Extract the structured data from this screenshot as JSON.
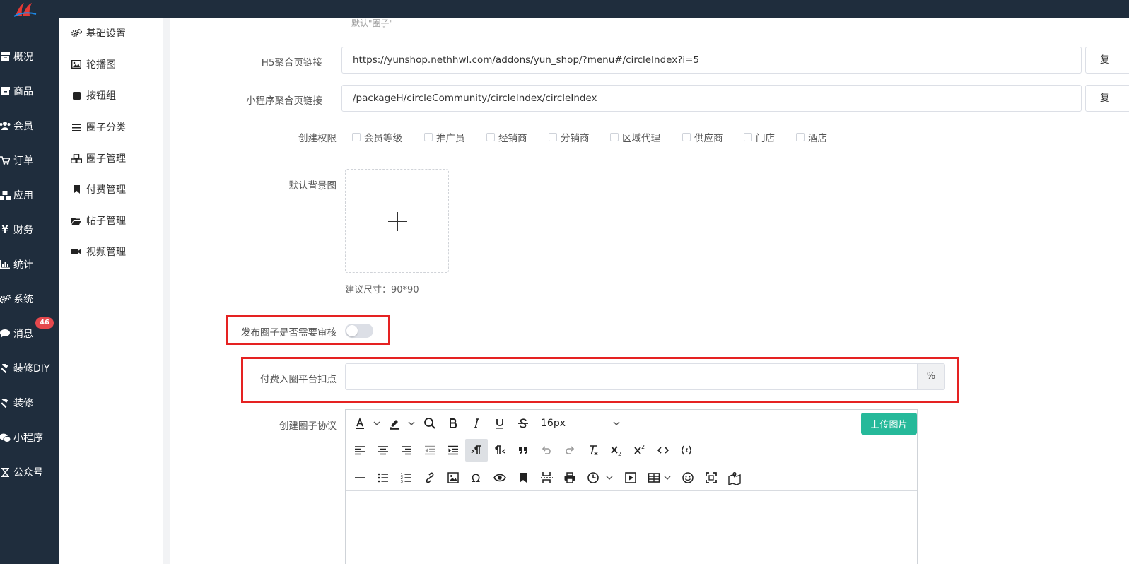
{
  "nav": {
    "items": [
      {
        "label": "概况",
        "icon": "archive-icon"
      },
      {
        "label": "商品",
        "icon": "archive-icon"
      },
      {
        "label": "会员",
        "icon": "users-icon"
      },
      {
        "label": "订单",
        "icon": "cart-icon"
      },
      {
        "label": "应用",
        "icon": "cubes-icon"
      },
      {
        "label": "财务",
        "icon": "yen-icon"
      },
      {
        "label": "统计",
        "icon": "bar-chart-icon"
      },
      {
        "label": "系统",
        "icon": "gears-icon"
      },
      {
        "label": "消息",
        "icon": "comment-icon",
        "badge": "46"
      },
      {
        "label": "装修DIY",
        "icon": "gavel-icon"
      },
      {
        "label": "装修",
        "icon": "gavel-icon"
      },
      {
        "label": "小程序",
        "icon": "wechat-icon"
      },
      {
        "label": "公众号",
        "icon": "hourglass-icon"
      }
    ]
  },
  "subnav": {
    "items": [
      {
        "label": "基础设置",
        "icon": "gears-icon"
      },
      {
        "label": "轮播图",
        "icon": "image-icon"
      },
      {
        "label": "按钮组",
        "icon": "stop-icon"
      },
      {
        "label": "圈子分类",
        "icon": "list-icon"
      },
      {
        "label": "圈子管理",
        "icon": "cubes-icon"
      },
      {
        "label": "付费管理",
        "icon": "bookmark-icon"
      },
      {
        "label": "帖子管理",
        "icon": "folder-open-icon"
      },
      {
        "label": "视频管理",
        "icon": "video-camera-icon"
      }
    ]
  },
  "form": {
    "top_hint": "默认\"圈子\"",
    "h5_label": "H5聚合页链接",
    "h5_value": "https://yunshop.nethhwl.com/addons/yun_shop/?menu#/circleIndex?i=5",
    "mini_label": "小程序聚合页链接",
    "mini_value": "/packageH/circleCommunity/circleIndex/circleIndex",
    "copy_label": "复",
    "permission_label": "创建权限",
    "permissions": [
      "会员等级",
      "推广员",
      "经销商",
      "分销商",
      "区域代理",
      "供应商",
      "门店",
      "酒店"
    ],
    "bg_label": "默认背景图",
    "size_hint": "建议尺寸：90*90",
    "review_label": "发布圈子是否需要审核",
    "review_enabled": false,
    "fee_label": "付费入圈平台扣点",
    "fee_value": "",
    "fee_unit": "%",
    "agreement_label": "创建圈子协议"
  },
  "editor": {
    "font_size": "16px",
    "upload_image_label": "上传图片",
    "active_tool": "pilcrow-ltr-icon"
  },
  "colors": {
    "sidebar": "#1f2d3d",
    "highlight": "#e52222",
    "accent": "#26b99a",
    "badge": "#e5484d"
  }
}
